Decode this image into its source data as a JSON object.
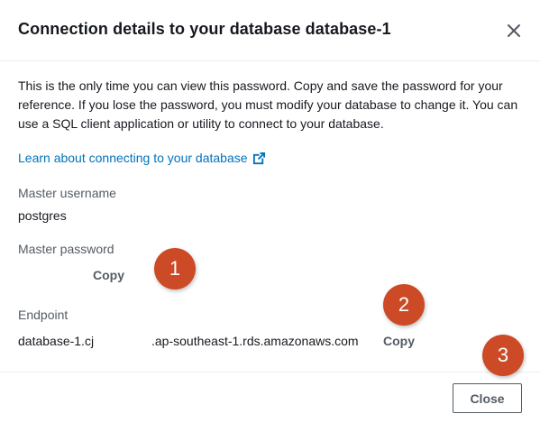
{
  "modal": {
    "title": "Connection details to your database database-1",
    "close_icon": "close-icon",
    "description": "This is the only time you can view this password. Copy and save the password for your reference. If you lose the password, you must modify your database to change it. You can use a SQL client application or utility to connect to your database.",
    "learn_link": {
      "label": "Learn about connecting to your database",
      "icon": "external-link-icon"
    },
    "username": {
      "label": "Master username",
      "value": "postgres"
    },
    "password": {
      "label": "Master password",
      "copy_label": "Copy"
    },
    "endpoint": {
      "label": "Endpoint",
      "value_start": "database-1.cj",
      "value_end": ".ap-southeast-1.rds.amazonaws.com",
      "copy_label": "Copy"
    },
    "footer": {
      "close_label": "Close"
    }
  },
  "annotations": {
    "badge_1": "1",
    "badge_2": "2",
    "badge_3": "3"
  },
  "colors": {
    "link": "#0073bb",
    "badge": "#cc4a25",
    "text": "#16191f",
    "label": "#545b64"
  }
}
